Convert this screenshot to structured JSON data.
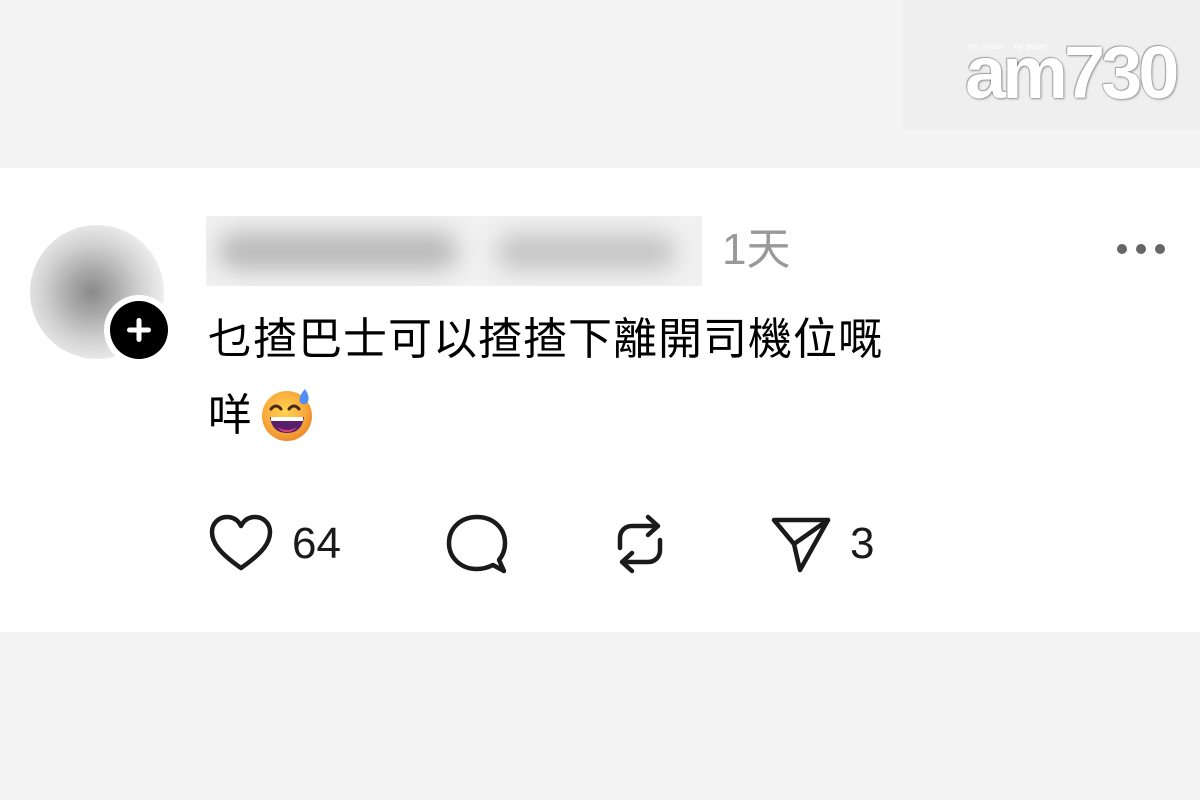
{
  "watermark": {
    "tagline": "my choice · my paper",
    "logo": "am730"
  },
  "post": {
    "timestamp": "1天",
    "text_line1": "乜揸巴士可以揸揸下離開司機位嘅",
    "text_line2": "咩",
    "emoji": "grinning-face-with-sweat"
  },
  "actions": {
    "like_count": "64",
    "share_count": "3"
  },
  "colors": {
    "card_background": "#ffffff",
    "page_background": "#f4f4f4",
    "timestamp": "#999999",
    "text": "#000000"
  }
}
